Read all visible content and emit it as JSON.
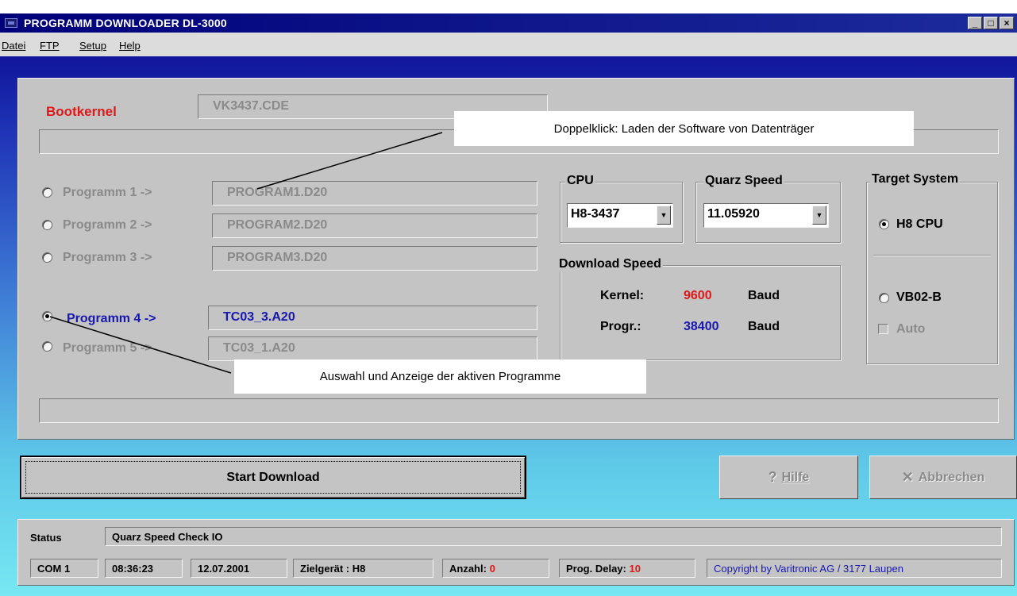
{
  "window": {
    "title": "PROGRAMM DOWNLOADER DL-3000",
    "controls": [
      "_",
      "□",
      "×"
    ]
  },
  "menu": [
    "Datei",
    "FTP",
    "Setup",
    "Help"
  ],
  "bootkernel": {
    "label": "Bootkernel",
    "file": "VK3437.CDE"
  },
  "programs": [
    {
      "label": "Programm 1 ->",
      "file": "PROGRAM1.D20",
      "selected": false
    },
    {
      "label": "Programm 2 ->",
      "file": "PROGRAM2.D20",
      "selected": false
    },
    {
      "label": "Programm 3 ->",
      "file": "PROGRAM3.D20",
      "selected": false
    },
    {
      "label": "Programm 4 ->",
      "file": "TC03_3.A20",
      "selected": true
    },
    {
      "label": "Programm 5 ->",
      "file": "TC03_1.A20",
      "selected": false
    }
  ],
  "cpu": {
    "title": "CPU",
    "value": "H8-3437"
  },
  "quarz": {
    "title": "Quarz Speed",
    "value": "11.05920"
  },
  "download_speed": {
    "title": "Download Speed",
    "kernel_label": "Kernel:",
    "kernel_value": "9600",
    "progr_label": "Progr.:",
    "progr_value": "38400",
    "unit": "Baud"
  },
  "target_system": {
    "title": "Target System",
    "options": [
      "H8 CPU",
      "VB02-B"
    ],
    "selected": "H8 CPU",
    "auto_label": "Auto"
  },
  "callouts": {
    "top": "Doppelklick: Laden der Software von Datenträger",
    "bottom": "Auswahl und Anzeige der aktiven Programme"
  },
  "buttons": {
    "start": "Start Download",
    "help": "Hilfe",
    "cancel": "Abbrechen"
  },
  "status": {
    "label": "Status",
    "text": "Quarz Speed Check IO",
    "port": "COM 1",
    "time": "08:36:23",
    "date": "12.07.2001",
    "zielgeraet": "Zielgerät : H8",
    "anzahl_label": "Anzahl:",
    "anzahl_value": "0",
    "delay_label": "Prog. Delay:",
    "delay_value": "10",
    "copyright": "Copyright by Varitronic AG / 3177 Laupen"
  },
  "colors": {
    "title_bar": "#00007a",
    "panel": "#c4c4c4",
    "accent_red": "#e01818",
    "accent_blue": "#1818b0"
  }
}
